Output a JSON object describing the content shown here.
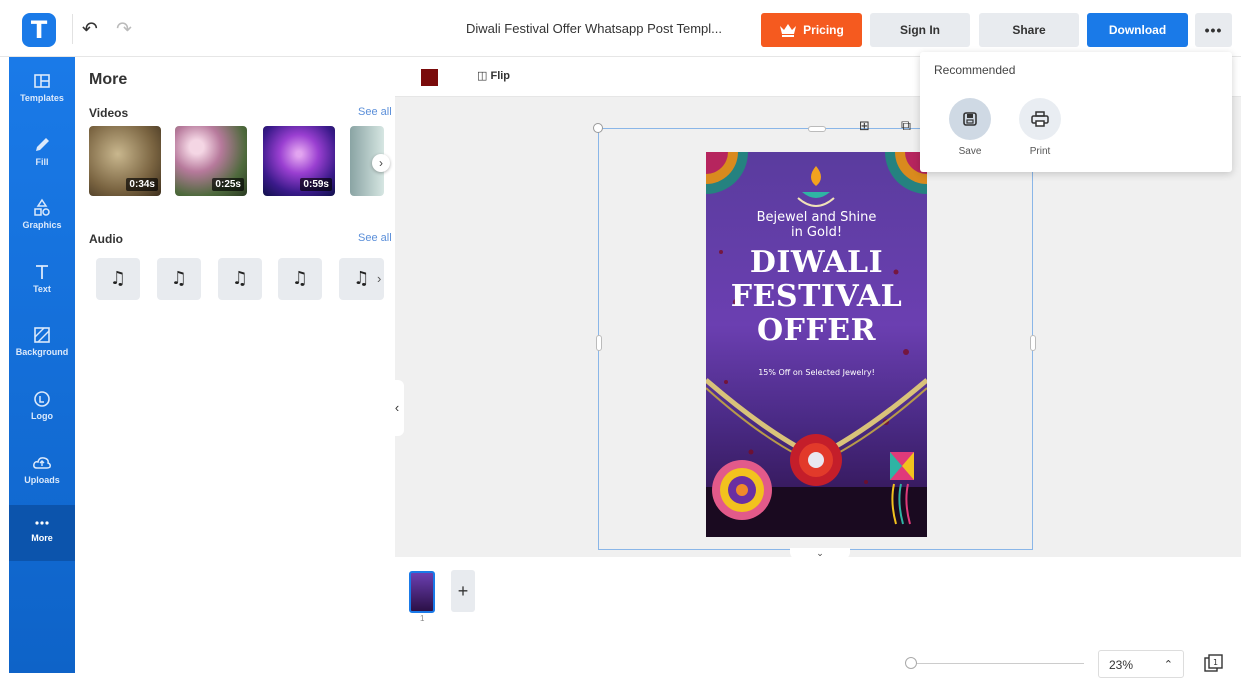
{
  "header": {
    "doc_title": "Diwali Festival Offer Whatsapp Post Templ...",
    "pricing_label": "Pricing",
    "signin_label": "Sign In",
    "share_label": "Share",
    "download_label": "Download",
    "more_label": "•••"
  },
  "sidebar": {
    "items": [
      {
        "label": "Templates",
        "icon": "templates-icon"
      },
      {
        "label": "Fill",
        "icon": "pencil-icon"
      },
      {
        "label": "Graphics",
        "icon": "shapes-icon"
      },
      {
        "label": "Text",
        "icon": "text-icon"
      },
      {
        "label": "Background",
        "icon": "background-icon"
      },
      {
        "label": "Logo",
        "icon": "logo-icon"
      },
      {
        "label": "Uploads",
        "icon": "cloud-upload-icon"
      },
      {
        "label": "More",
        "icon": "more-dots-icon",
        "active": true
      }
    ]
  },
  "panel": {
    "title": "More",
    "videos_label": "Videos",
    "see_all": "See all",
    "videos": [
      {
        "duration": "0:34s"
      },
      {
        "duration": "0:25s"
      },
      {
        "duration": "0:59s"
      }
    ],
    "audio_label": "Audio"
  },
  "toolbar": {
    "color": "#7a0b0b",
    "flip_label": "Flip"
  },
  "poster": {
    "tagline": "Bejewel and Shine in Gold!",
    "headline_1": "DIWALI",
    "headline_2": "FESTIVAL",
    "headline_3": "OFFER",
    "subtext": "15% Off on Selected Jewelry!"
  },
  "dropdown": {
    "title": "Recommended",
    "save_label": "Save",
    "print_label": "Print"
  },
  "footer": {
    "page_number": "1",
    "zoom": "23%"
  },
  "colors": {
    "brand": "#1a7ae8",
    "pricing": "#f55a1f"
  }
}
